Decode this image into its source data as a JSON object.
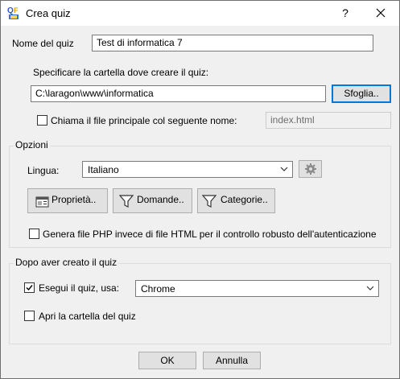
{
  "window": {
    "title": "Crea quiz",
    "help_glyph": "?",
    "icons": {
      "app": "qf-app-icon",
      "close": "close-icon"
    }
  },
  "quiz_name": {
    "label": "Nome del quiz",
    "value": "Test di informatica 7"
  },
  "folder": {
    "instruction": "Specificare la cartella dove creare il quiz:",
    "path": "C:\\laragon\\www\\informatica",
    "browse_label": "Sfoglia.."
  },
  "main_file": {
    "checkbox_label": "Chiama il file principale col seguente nome:",
    "checked": false,
    "value": "index.html"
  },
  "options": {
    "group_title": "Opzioni",
    "language_label": "Lingua:",
    "language_value": "Italiano",
    "buttons": {
      "properties": "Proprietà..",
      "questions": "Domande..",
      "categories": "Categorie.."
    },
    "php_checkbox_label": "Genera file PHP invece di file HTML per il controllo robusto dell'autenticazione",
    "php_checked": false
  },
  "after": {
    "group_title": "Dopo aver creato il quiz",
    "run_label": "Esegui il quiz, usa:",
    "run_checked": true,
    "browser_value": "Chrome",
    "open_folder_label": "Apri la cartella del quiz",
    "open_folder_checked": false
  },
  "footer": {
    "ok_label": "OK",
    "cancel_label": "Annulla"
  },
  "colors": {
    "accent": "#0078d7",
    "window_bg": "#f0f0f0",
    "titlebar_bg": "#ffffff"
  }
}
